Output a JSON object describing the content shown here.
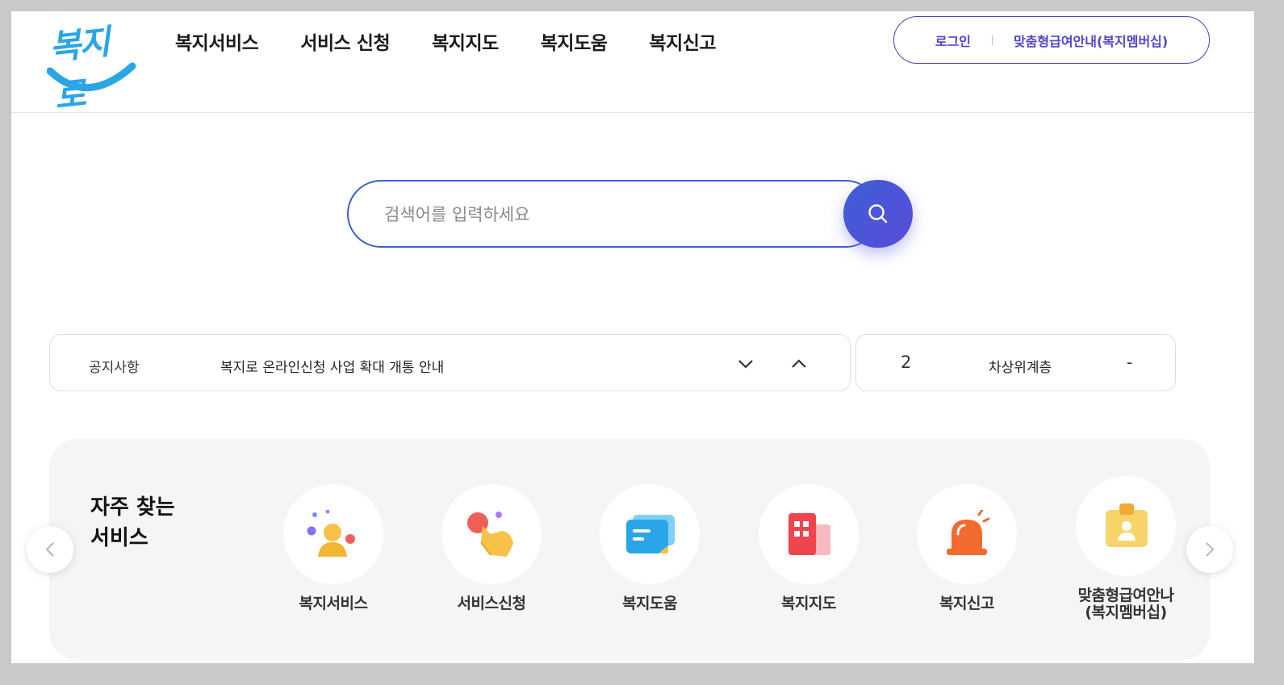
{
  "logo": {
    "text": "복지로"
  },
  "gnb": {
    "items": [
      {
        "label": "복지서비스"
      },
      {
        "label": "서비스 신청"
      },
      {
        "label": "복지지도"
      },
      {
        "label": "복지도움"
      },
      {
        "label": "복지신고"
      }
    ]
  },
  "util": {
    "login": "로그인",
    "membership": "맞춤형급여안내(복지멤버십)"
  },
  "search": {
    "placeholder": "검색어를 입력하세요",
    "value": ""
  },
  "notice": {
    "label": "공지사항",
    "text": "복지로 온라인신청 사업 확대 개통 안내"
  },
  "info": {
    "number": "2",
    "label": "차상위계층",
    "value": "-"
  },
  "services": {
    "title_line1": "자주 찾는",
    "title_line2": "서비스",
    "items": [
      {
        "label": "복지서비스",
        "icon": "people-icon"
      },
      {
        "label": "서비스신청",
        "icon": "hand-pointer-icon"
      },
      {
        "label": "복지도움",
        "icon": "chat-card-icon"
      },
      {
        "label": "복지지도",
        "icon": "building-map-icon"
      },
      {
        "label": "복지신고",
        "icon": "siren-icon"
      },
      {
        "label_line1": "맞춤형급여안나",
        "label_line2": "(복지멤버십)",
        "icon": "id-badge-icon"
      }
    ]
  },
  "colors": {
    "primary": "#3d5fd6",
    "accent_purple": "#5145c8",
    "logo_blue": "#2aa6e8",
    "panel_bg": "#f5f5f5"
  }
}
